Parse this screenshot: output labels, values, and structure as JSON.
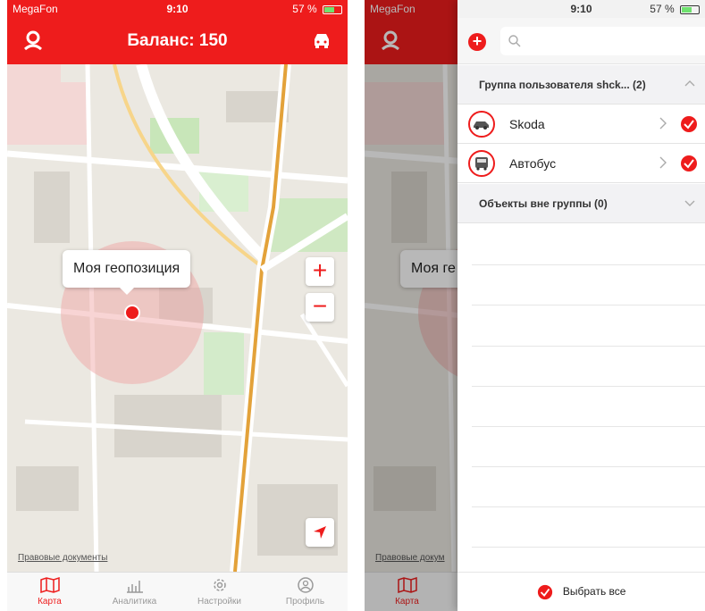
{
  "status": {
    "carrier": "MegaFon",
    "time": "9:10",
    "battery_left": "57 %",
    "battery_right": "57 %",
    "battery_level": 0.57
  },
  "header": {
    "title": "Баланс: 150",
    "left_icon": "user-pin-icon",
    "right_icon": "car-icon"
  },
  "map": {
    "bubble": "Моя геопозиция",
    "zoom_in": "+",
    "zoom_out": "−",
    "legal": "Правовые документы",
    "legal_cut": "Правовые докум",
    "bubble_cut": "Моя ге"
  },
  "tabs": [
    {
      "label": "Карта",
      "icon": "map-icon",
      "active": true
    },
    {
      "label": "Аналитика",
      "icon": "analytics-icon",
      "active": false
    },
    {
      "label": "Настройки",
      "icon": "gear-icon",
      "active": false
    },
    {
      "label": "Профиль",
      "icon": "profile-icon",
      "active": false
    }
  ],
  "drawer": {
    "search_placeholder": "",
    "group1": {
      "label": "Группа пользователя shck... (2)"
    },
    "items": [
      {
        "name": "Skoda",
        "icon": "car-icon",
        "checked": true
      },
      {
        "name": "Автобус",
        "icon": "bus-icon",
        "checked": true
      }
    ],
    "group2": {
      "label": "Объекты вне группы (0)"
    },
    "select_all": "Выбрать все"
  },
  "colors": {
    "accent": "#ee1c1c",
    "tab_inactive": "#999999"
  }
}
